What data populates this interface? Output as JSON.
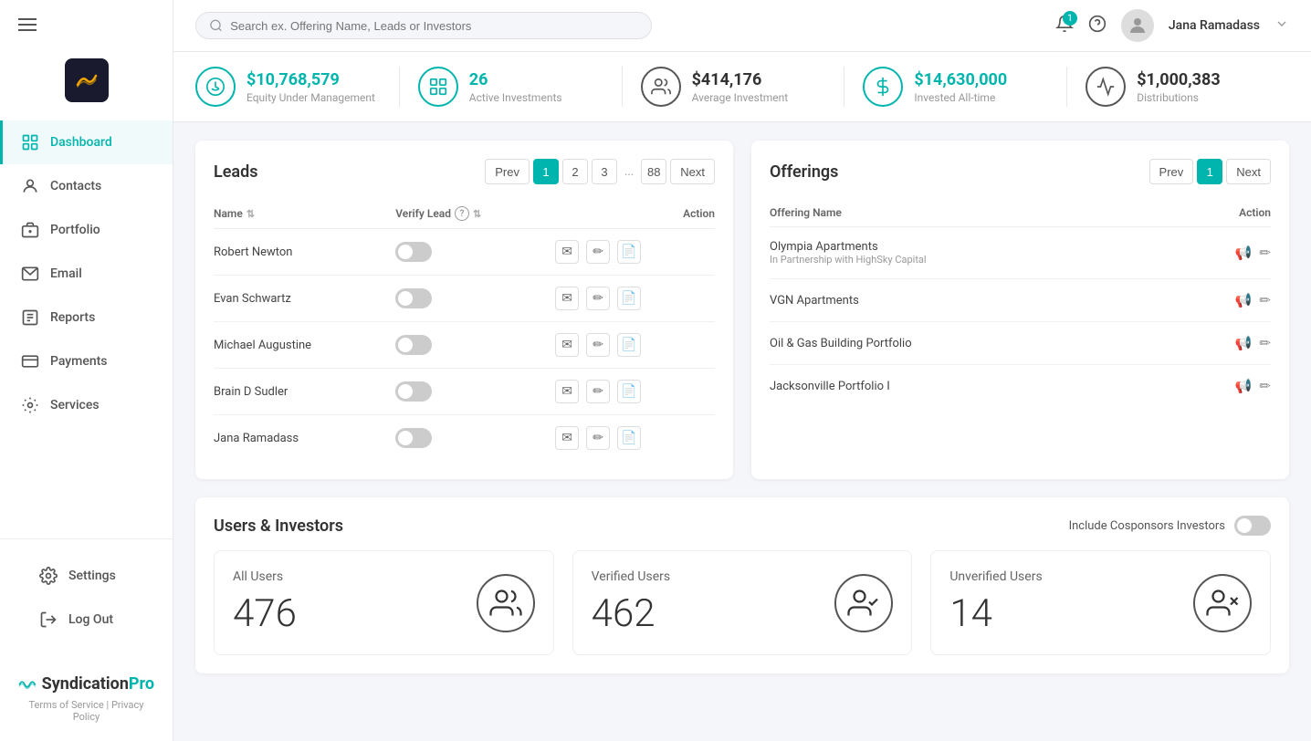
{
  "sidebar": {
    "hamburger_label": "menu",
    "items": [
      {
        "id": "dashboard",
        "label": "Dashboard",
        "icon": "home",
        "active": true
      },
      {
        "id": "contacts",
        "label": "Contacts",
        "icon": "person"
      },
      {
        "id": "portfolio",
        "label": "Portfolio",
        "icon": "briefcase"
      },
      {
        "id": "email",
        "label": "Email",
        "icon": "email"
      },
      {
        "id": "reports",
        "label": "Reports",
        "icon": "reports"
      },
      {
        "id": "payments",
        "label": "Payments",
        "icon": "payments"
      },
      {
        "id": "services",
        "label": "Services",
        "icon": "services"
      }
    ],
    "bottom_items": [
      {
        "id": "settings",
        "label": "Settings",
        "icon": "gear"
      },
      {
        "id": "logout",
        "label": "Log Out",
        "icon": "logout"
      }
    ],
    "footer": {
      "brand": "SyndicationPro",
      "terms": "Terms of Service",
      "privacy": "Privacy Policy"
    }
  },
  "topbar": {
    "search_placeholder": "Search ex. Offering Name, Leads or Investors",
    "notification_count": "1",
    "user_name": "Jana Ramadass"
  },
  "stats": [
    {
      "id": "equity",
      "value": "$10,768,579",
      "label": "Equity Under Management",
      "color": "green"
    },
    {
      "id": "investments",
      "value": "26",
      "label": "Active Investments",
      "color": "green"
    },
    {
      "id": "average",
      "value": "$414,176",
      "label": "Average Investment",
      "color": "dark"
    },
    {
      "id": "invested",
      "value": "$14,630,000",
      "label": "Invested All-time",
      "color": "green"
    },
    {
      "id": "distributions",
      "value": "$1,000,383",
      "label": "Distributions",
      "color": "dark"
    }
  ],
  "leads": {
    "title": "Leads",
    "pagination": {
      "prev": "Prev",
      "next": "Next",
      "current": "1",
      "pages": [
        "1",
        "2",
        "3",
        "...",
        "88"
      ]
    },
    "columns": {
      "name": "Name",
      "verify_lead": "Verify Lead",
      "action": "Action"
    },
    "rows": [
      {
        "name": "Robert Newton",
        "verified": false
      },
      {
        "name": "Evan Schwartz",
        "verified": false
      },
      {
        "name": "Michael Augustine",
        "verified": false
      },
      {
        "name": "Brain D Sudler",
        "verified": false
      },
      {
        "name": "Jana Ramadass",
        "verified": false
      }
    ]
  },
  "offerings": {
    "title": "Offerings",
    "pagination": {
      "prev": "Prev",
      "next": "Next",
      "current": "1"
    },
    "columns": {
      "name": "Offering Name",
      "action": "Action"
    },
    "rows": [
      {
        "name": "Olympia Apartments",
        "sub": "In Partnership with HighSky Capital"
      },
      {
        "name": "VGN Apartments",
        "sub": ""
      },
      {
        "name": "Oil & Gas Building Portfolio",
        "sub": ""
      },
      {
        "name": "Jacksonville Portfolio I",
        "sub": ""
      }
    ]
  },
  "users_investors": {
    "title": "Users & Investors",
    "include_label": "Include Cosponsors Investors",
    "cards": [
      {
        "id": "all_users",
        "label": "All Users",
        "value": "476"
      },
      {
        "id": "verified_users",
        "label": "Verified Users",
        "value": "462"
      },
      {
        "id": "unverified_users",
        "label": "Unverified Users",
        "value": "14"
      }
    ]
  }
}
